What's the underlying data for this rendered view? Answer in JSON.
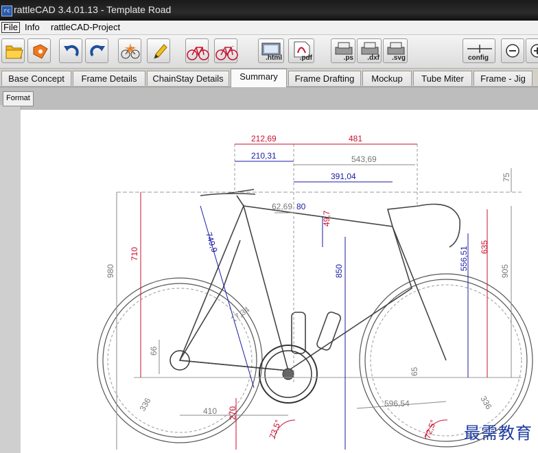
{
  "window": {
    "title": "rattleCAD  3.4.01.13 - Template Road",
    "icon": "rc"
  },
  "menu": {
    "file": "File",
    "info": "Info",
    "project": "rattleCAD-Project"
  },
  "toolbar": {
    "icons": [
      "open-folder-icon",
      "save-icon",
      "undo-icon",
      "redo-icon",
      "bike-update-icon",
      "pencil-icon",
      "bike-red-icon",
      "bike-red-ghost-icon"
    ],
    "html_label": ".html",
    "pdf_label": ".pdf",
    "ps_label": ".ps",
    "dxf_label": ".dxf",
    "svg_label": ".svg",
    "config_label": "config"
  },
  "tabs": [
    "Base Concept",
    "Frame Details",
    "ChainStay Details",
    "Summary",
    "Frame Drafting",
    "Mockup",
    "Tube Miter",
    "Frame - Jig"
  ],
  "active_tab": "Summary",
  "format_button": "Format",
  "drawing": {
    "colors": {
      "red": "#c8102e",
      "blue": "#1a1aa6",
      "grey": "#8a8a8a",
      "frame": "#444444"
    },
    "dims": {
      "d212": "212,69",
      "d481": "481",
      "d210": "210,31",
      "d543": "543,69",
      "d391": "391,04",
      "d75": "75",
      "d62": "62,69",
      "d80": "80",
      "d497": "49,7",
      "d749": "749,9",
      "d710": "710",
      "d980": "980",
      "d850": "850",
      "d556": "556,51",
      "d635": "635",
      "d905": "905",
      "d1734": "17,34",
      "d66": "66",
      "d65": "65",
      "d596": "596,54",
      "d336a": "336",
      "d336b": "336",
      "d410": "410",
      "d270": "270",
      "a735": "73,5°",
      "a725": "72,5°"
    }
  },
  "watermark": "最需教育"
}
